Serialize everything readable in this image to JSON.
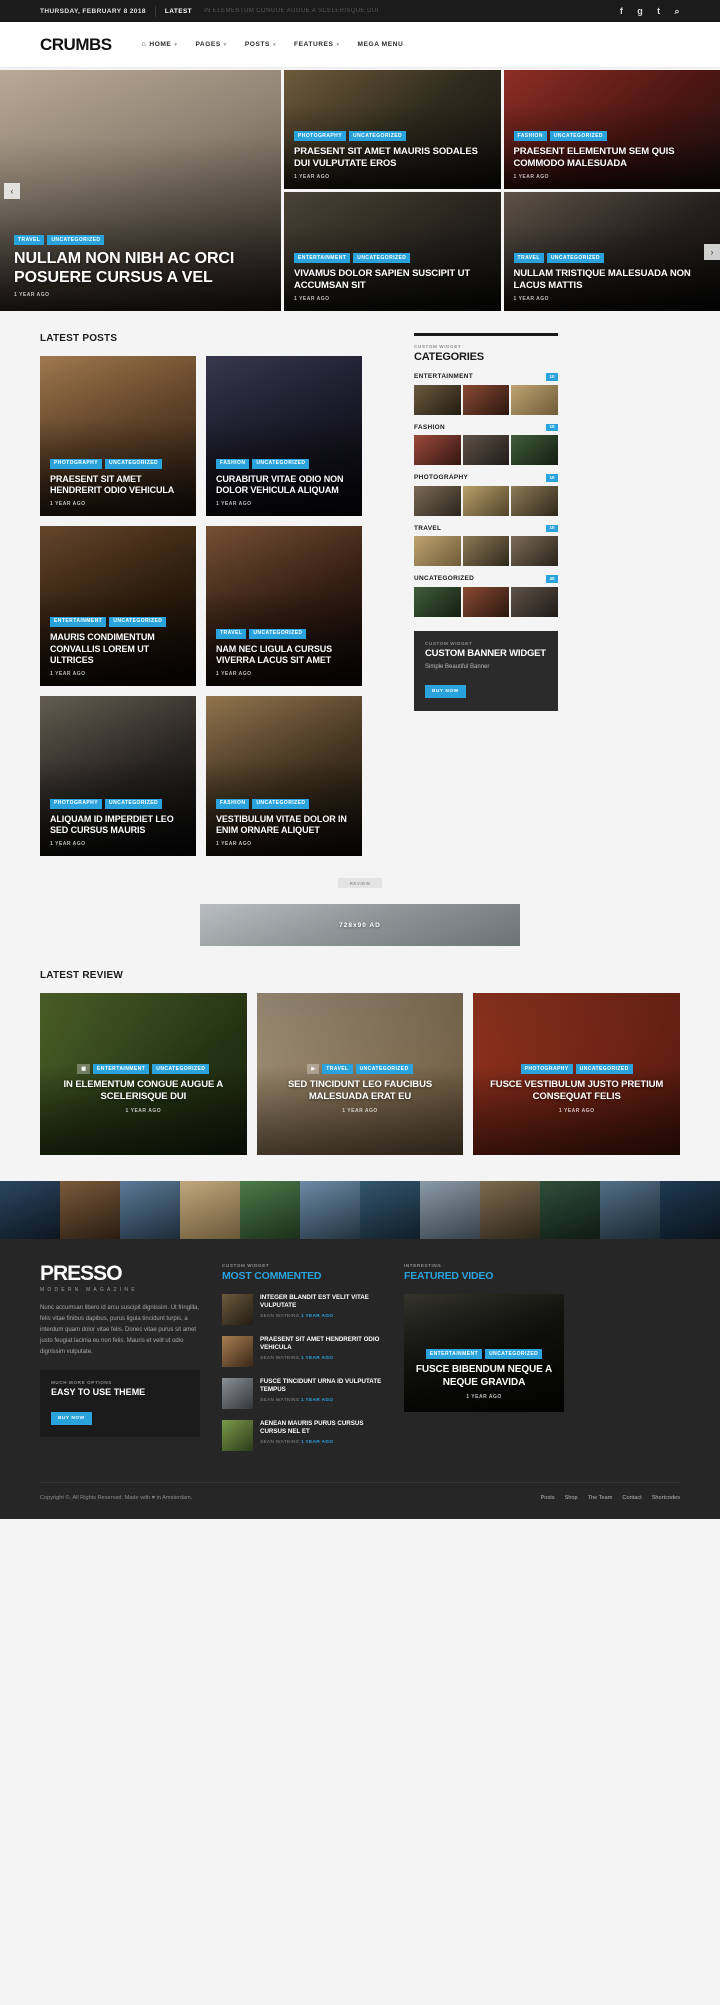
{
  "topbar": {
    "date": "THURSDAY, FEBRUARY 8 2018",
    "latest_label": "LATEST",
    "ticker": "IN ELEMENTUM CONGUE AUGUE A SCELERISQUE DUI",
    "social": [
      {
        "name": "facebook-icon",
        "glyph": "f"
      },
      {
        "name": "google-plus-icon",
        "glyph": "g"
      },
      {
        "name": "twitter-icon",
        "glyph": "t"
      },
      {
        "name": "search-icon",
        "glyph": "⌕"
      }
    ]
  },
  "header": {
    "logo": "CRUMBS",
    "nav": [
      {
        "label": "HOME",
        "caret": "▾",
        "home": true
      },
      {
        "label": "PAGES",
        "caret": "▾"
      },
      {
        "label": "POSTS",
        "caret": "▾"
      },
      {
        "label": "FEATURES",
        "caret": "▾"
      },
      {
        "label": "MEGA MENU",
        "caret": ""
      }
    ]
  },
  "hero": {
    "main": {
      "badges": [
        "TRAVEL",
        "UNCATEGORIZED"
      ],
      "title": "NULLAM NON NIBH AC ORCI POSUERE CURSUS A VEL",
      "meta": "1 YEAR AGO"
    },
    "cells": [
      {
        "badges": [
          "PHOTOGRAPHY",
          "UNCATEGORIZED"
        ],
        "title": "PRAESENT SIT AMET MAURIS SODALES DUI VULPUTATE EROS",
        "meta": "1 YEAR AGO"
      },
      {
        "badges": [
          "FASHION",
          "UNCATEGORIZED"
        ],
        "title": "PRAESENT ELEMENTUM SEM QUIS COMMODO MALESUADA",
        "meta": "1 YEAR AGO"
      },
      {
        "badges": [
          "ENTERTAINMENT",
          "UNCATEGORIZED"
        ],
        "title": "VIVAMUS DOLOR SAPIEN SUSCIPIT UT ACCUMSAN SIT",
        "meta": "1 YEAR AGO"
      },
      {
        "badges": [
          "TRAVEL",
          "UNCATEGORIZED"
        ],
        "title": "NULLAM TRISTIQUE MALESUADA NON LACUS MATTIS",
        "meta": "1 YEAR AGO"
      }
    ],
    "arrow_prev": "‹",
    "arrow_next": "›"
  },
  "latest_posts": {
    "title": "LATEST POSTS",
    "cards": [
      {
        "badges": [
          "PHOTOGRAPHY",
          "UNCATEGORIZED"
        ],
        "title": "PRAESENT SIT AMET HENDRERIT ODIO VEHICULA",
        "meta": "1 YEAR AGO"
      },
      {
        "badges": [
          "FASHION",
          "UNCATEGORIZED"
        ],
        "title": "CURABITUR VITAE ODIO NON DOLOR VEHICULA ALIQUAM",
        "meta": "1 YEAR AGO"
      },
      {
        "badges": [
          "ENTERTAINMENT",
          "UNCATEGORIZED"
        ],
        "title": "MAURIS CONDIMENTUM CONVALLIS LOREM UT ULTRICES",
        "meta": "1 YEAR AGO"
      },
      {
        "badges": [
          "TRAVEL",
          "UNCATEGORIZED"
        ],
        "title": "NAM NEC LIGULA CURSUS VIVERRA LACUS SIT AMET",
        "meta": "1 YEAR AGO"
      },
      {
        "badges": [
          "PHOTOGRAPHY",
          "UNCATEGORIZED"
        ],
        "title": "ALIQUAM ID IMPERDIET LEO SED CURSUS MAURIS",
        "meta": "1 YEAR AGO"
      },
      {
        "badges": [
          "FASHION",
          "UNCATEGORIZED"
        ],
        "title": "VESTIBULUM VITAE DOLOR IN ENIM ORNARE ALIQUET",
        "meta": "1 YEAR AGO"
      }
    ],
    "load_more": "REVIEW",
    "ad_text": "728x90 AD"
  },
  "sidebar": {
    "categories_widget": {
      "subtitle": "CUSTOM WIDGET",
      "title": "CATEGORIES",
      "items": [
        {
          "name": "ENTERTAINMENT",
          "count": "10"
        },
        {
          "name": "FASHION",
          "count": "10"
        },
        {
          "name": "PHOTOGRAPHY",
          "count": "10"
        },
        {
          "name": "TRAVEL",
          "count": "10"
        },
        {
          "name": "UNCATEGORIZED",
          "count": "40"
        }
      ]
    },
    "banner_widget": {
      "subtitle": "CUSTOM WIDGET",
      "title": "CUSTOM BANNER WIDGET",
      "text": "Simple Beautiful Banner",
      "button": "BUY NOW"
    }
  },
  "review": {
    "title": "LATEST REVIEW",
    "cards": [
      {
        "icon": "gallery-icon",
        "badges": [
          "ENTERTAINMENT",
          "UNCATEGORIZED"
        ],
        "title": "IN ELEMENTUM CONGUE AUGUE A SCELERISQUE DUI",
        "meta": "1 YEAR AGO"
      },
      {
        "icon": "video-icon",
        "badges": [
          "TRAVEL",
          "UNCATEGORIZED"
        ],
        "title": "SED TINCIDUNT LEO FAUCIBUS MALESUADA ERAT EU",
        "meta": "1 YEAR AGO"
      },
      {
        "icon": "",
        "badges": [
          "PHOTOGRAPHY",
          "UNCATEGORIZED"
        ],
        "title": "FUSCE VESTIBULUM JUSTO PRETIUM CONSEQUAT FELIS",
        "meta": "1 YEAR AGO"
      }
    ]
  },
  "footer": {
    "logo": "PRESSO",
    "logo_sub": "MODERN MAGAZINE",
    "about": "Nunc accumsan libero id arcu suscipit dignissim. Ut fringilla, felis vitae finibus dapibus, purus ligula tincidunt turpis, a interdum quam dolor vitae felis. Donec vitae purus sit amet justo feugiat lacinia eu non felis. Mauris et velit ut odio dignissim vulputate.",
    "promo": {
      "subtitle": "MUCH MORE OPTIONS",
      "title": "EASY TO USE THEME",
      "button": "BUY NOW"
    },
    "most_commented": {
      "subtitle": "CUSTOM WIDGET",
      "title": "MOST COMMENTED",
      "items": [
        {
          "title": "INTEGER BLANDIT EST VELIT VITAE VULPUTATE",
          "author": "SEAN WATKINS",
          "time": "1 YEAR AGO"
        },
        {
          "title": "PRAESENT SIT AMET HENDRERIT ODIO VEHICULA",
          "author": "SEAN WATKINS",
          "time": "1 YEAR AGO"
        },
        {
          "title": "FUSCE TINCIDUNT URNA ID VULPUTATE TEMPUS",
          "author": "SEAN WATKINS",
          "time": "1 YEAR AGO"
        },
        {
          "title": "AENEAN MAURIS PURUS CURSUS CURSUS NEL ET",
          "author": "SEAN WATKINS",
          "time": "1 YEAR AGO"
        }
      ]
    },
    "featured_video": {
      "subtitle": "INTERESTING",
      "title": "FEATURED VIDEO",
      "badges": [
        "ENTERTAINMENT",
        "UNCATEGORIZED"
      ],
      "video_title": "FUSCE BIBENDUM NEQUE A NEQUE GRAVIDA",
      "meta": "1 YEAR AGO"
    },
    "copyright": "Copyright ©, All Rights Reserved. Made with ♥ in Amsterdam.",
    "links": [
      "Posts",
      "Shop",
      "The Team",
      "Contact",
      "Shortcodes"
    ]
  }
}
